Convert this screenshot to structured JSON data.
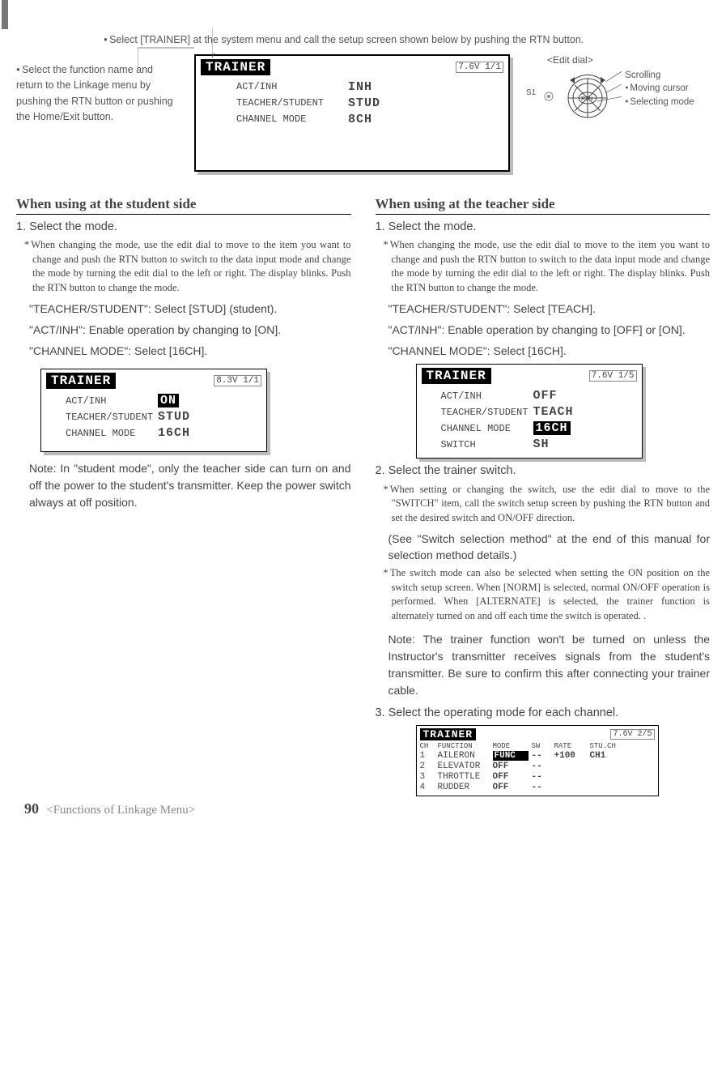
{
  "top_instruction": "Select [TRAINER] at the system menu and call the setup screen shown below by pushing the RTN button.",
  "left_note": "Select the function name and return to the Linkage menu by pushing the RTN button or pushing the Home/Exit button.",
  "main_lcd": {
    "title": "TRAINER",
    "batt": "7.6V 1/1",
    "rows": [
      {
        "label": "ACT/INH",
        "value": "INH"
      },
      {
        "label": "TEACHER/STUDENT",
        "value": "STUD"
      },
      {
        "label": "CHANNEL MODE",
        "value": "8CH"
      }
    ]
  },
  "dial": {
    "title": "<Edit dial>",
    "s1": "S1",
    "scrolling": "Scrolling",
    "moving": "Moving cursor",
    "selecting": "Selecting mode"
  },
  "student": {
    "heading": "When using at the student side",
    "step1": "1. Select the mode.",
    "note": "When changing the mode, use the edit dial to move to the item you want to change and push the RTN button to switch to the data input mode and change the mode by turning the edit dial to the left or right. The display blinks. Push the RTN button to change the mode.",
    "l1": "\"TEACHER/STUDENT\": Select [STUD] (student).",
    "l2": "\"ACT/INH\": Enable operation by changing to [ON].",
    "l3": "\"CHANNEL MODE\": Select [16CH].",
    "lcd": {
      "title": "TRAINER",
      "batt": "8.3V 1/1",
      "rows": [
        {
          "label": "ACT/INH",
          "value": "ON",
          "inverted": true
        },
        {
          "label": "TEACHER/STUDENT",
          "value": "STUD"
        },
        {
          "label": "CHANNEL MODE",
          "value": "16CH"
        }
      ]
    },
    "note2": "Note: In \"student mode\", only the teacher side can turn on and off the power to the student's transmitter. Keep the power switch always at off position."
  },
  "teacher": {
    "heading": "When using at the teacher side",
    "step1": "1. Select the mode.",
    "note": "When changing the mode, use the edit dial to move to the item you want to change and push the RTN button to switch to the data input mode and change the mode by turning the edit dial to the left or right. The display blinks. Push the RTN button to change the mode.",
    "l1": "\"TEACHER/STUDENT\": Select [TEACH].",
    "l2": "\"ACT/INH\": Enable operation by changing to [OFF] or [ON].",
    "l3": "\"CHANNEL MODE\": Select [16CH].",
    "lcd": {
      "title": "TRAINER",
      "batt": "7.6V 1/5",
      "rows": [
        {
          "label": "ACT/INH",
          "value": "OFF"
        },
        {
          "label": "TEACHER/STUDENT",
          "value": "TEACH"
        },
        {
          "label": "CHANNEL MODE",
          "value": "16CH",
          "inverted": true
        },
        {
          "label": "SWITCH",
          "value": "SH"
        }
      ]
    },
    "step2": "2. Select the trainer switch.",
    "note2": "When setting or changing the switch, use the edit dial to move to the \"SWITCH\" item, call the switch setup screen by pushing the RTN button and set the desired switch and ON/OFF direction.",
    "paren": "(See \"Switch selection method\" at the end of this manual for selection method details.)",
    "note3": "The switch mode can also be selected when setting the ON position on the switch setup screen. When [NORM] is selected, normal ON/OFF operation is performed. When [ALTERNATE] is selected, the trainer function is alternately turned on and off each time the switch is operated. .",
    "note4": "Note: The trainer function won't be turned on unless the Instructor's transmitter receives signals from the student's transmitter. Be sure to confirm this after connecting your trainer cable.",
    "step3": "3. Select the operating mode for each channel.",
    "table": {
      "title": "TRAINER",
      "batt": "7.6V 2/5",
      "headers": [
        "CH",
        "FUNCTION",
        "MODE",
        "SW",
        "RATE",
        "STU.CH"
      ],
      "rows": [
        {
          "ch": "1",
          "func": "AILERON",
          "mode": "FUNC",
          "mode_inv": true,
          "sw": "--",
          "rate": "+100",
          "stu": "CH1"
        },
        {
          "ch": "2",
          "func": "ELEVATOR",
          "mode": "OFF",
          "sw": "--",
          "rate": "",
          "stu": ""
        },
        {
          "ch": "3",
          "func": "THROTTLE",
          "mode": "OFF",
          "sw": "--",
          "rate": "",
          "stu": ""
        },
        {
          "ch": "4",
          "func": "RUDDER",
          "mode": "OFF",
          "sw": "--",
          "rate": "",
          "stu": ""
        }
      ]
    }
  },
  "footer": {
    "page": "90",
    "text": "<Functions of Linkage Menu>"
  }
}
